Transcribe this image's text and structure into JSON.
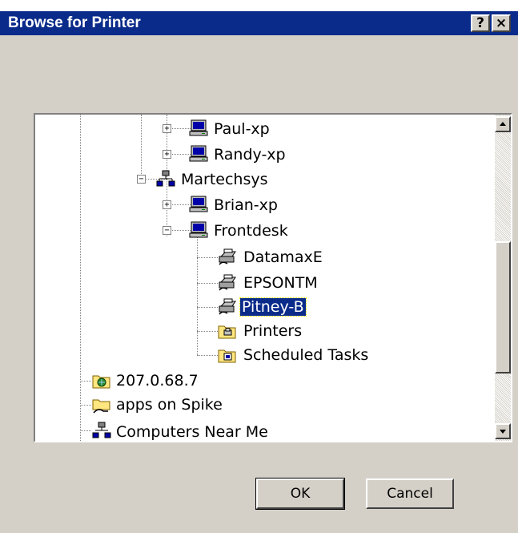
{
  "window": {
    "title": "Browse for Printer",
    "help_label": "?",
    "close_label": "×"
  },
  "tree": {
    "items": [
      {
        "label": "Paul-xp",
        "icon": "computer-icon",
        "expander": "+"
      },
      {
        "label": "Randy-xp",
        "icon": "computer-icon",
        "expander": "+"
      },
      {
        "label": "Martechsys",
        "icon": "workgroup-icon",
        "expander": "−"
      },
      {
        "label": "Brian-xp",
        "icon": "computer-icon",
        "expander": "+"
      },
      {
        "label": "Frontdesk",
        "icon": "computer-icon",
        "expander": "−"
      },
      {
        "label": "DatamaxE",
        "icon": "shared-printer-icon"
      },
      {
        "label": "EPSONTM",
        "icon": "shared-printer-icon"
      },
      {
        "label": "Pitney-B",
        "icon": "shared-printer-icon",
        "selected": true
      },
      {
        "label": "Printers",
        "icon": "printers-folder-icon"
      },
      {
        "label": "Scheduled Tasks",
        "icon": "scheduled-tasks-folder-icon"
      },
      {
        "label": "207.0.68.7",
        "icon": "network-folder-icon"
      },
      {
        "label": "apps on Spike",
        "icon": "shared-folder-icon"
      },
      {
        "label": "Computers Near Me",
        "icon": "computers-near-me-icon"
      }
    ]
  },
  "buttons": {
    "ok": "OK",
    "cancel": "Cancel"
  },
  "colors": {
    "titlebar": "#0a2b8a",
    "dialog": "#d4d0c8",
    "selection": "#0a2b8a"
  }
}
